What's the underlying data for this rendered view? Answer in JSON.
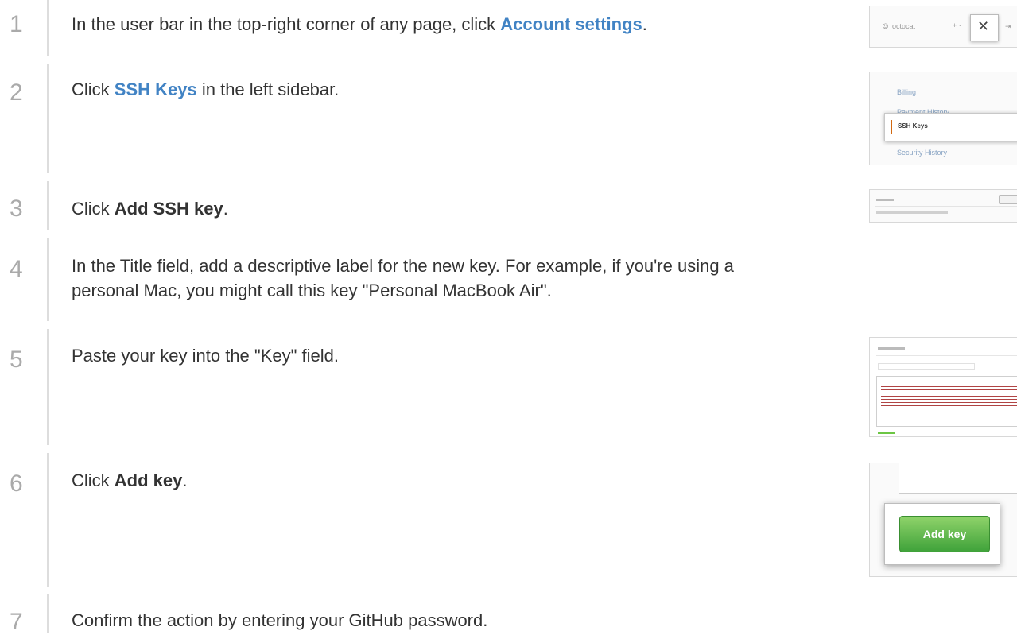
{
  "steps": [
    {
      "number": "1",
      "before": "In the user bar in the top-right corner of any page, click ",
      "emph": "Account settings",
      "after": "."
    },
    {
      "number": "2",
      "before": "Click ",
      "emph": "SSH Keys",
      "after": " in the left sidebar."
    },
    {
      "number": "3",
      "before": "Click ",
      "emph": "Add SSH key",
      "after": "."
    },
    {
      "number": "4",
      "line1": "In the Title field, add a descriptive label for the new key. For example, if you're using a",
      "line2": "personal Mac, you might call this key \"Personal MacBook Air\"."
    },
    {
      "number": "5",
      "text": "Paste your key into the \"Key\" field."
    },
    {
      "number": "6",
      "before": "Click ",
      "emph": "Add key",
      "after": "."
    },
    {
      "number": "7",
      "text": "Confirm the action by entering your GitHub password."
    }
  ],
  "thumbnails": {
    "userbar": {
      "username": "octocat",
      "plus": "+ ·"
    },
    "sidebar": {
      "items": [
        "Billing",
        "Payment History",
        "SSH Keys",
        "Security History"
      ]
    },
    "add_key_button": "Add key"
  },
  "colors": {
    "link": "#4183c4",
    "step_number": "#aaaaaa",
    "rule": "#dddddd",
    "active_marker": "#d26911",
    "button_green": "#3fa23a"
  }
}
